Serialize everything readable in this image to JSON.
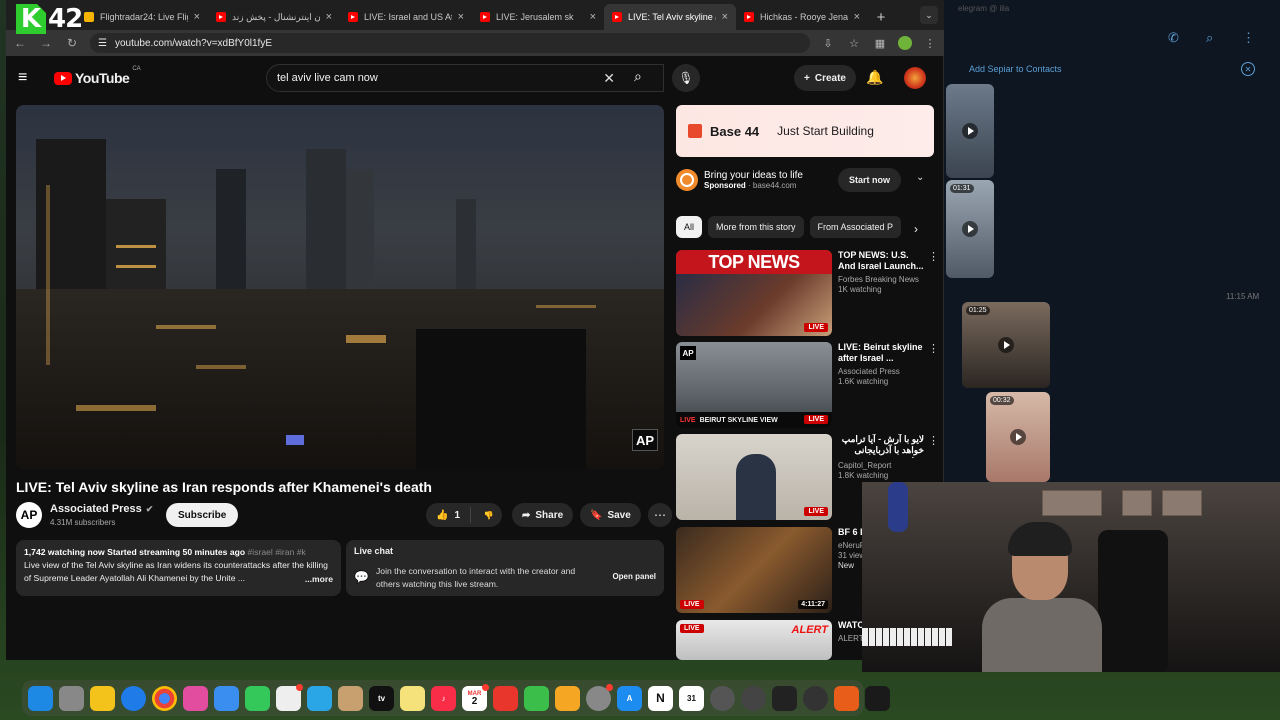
{
  "tabs": [
    {
      "title": "Flightradar24: Live Flig",
      "icon": "plane-icon",
      "active": false
    },
    {
      "title": "ایران اینترنشنال - پخش زند",
      "icon": "youtube-icon",
      "active": false
    },
    {
      "title": "LIVE: Israel and US Att",
      "icon": "youtube-icon",
      "active": false
    },
    {
      "title": "LIVE: Jerusalem sk",
      "icon": "youtube-icon",
      "active": false
    },
    {
      "title": "LIVE: Tel Aviv skyline a",
      "icon": "youtube-icon",
      "active": true
    },
    {
      "title": "Hichkas - Rooye Jenab",
      "icon": "youtube-icon",
      "active": false
    }
  ],
  "overlay_logo": {
    "letter": "K",
    "number": "42"
  },
  "url": "youtube.com/watch?v=xdBfY0l1fyE",
  "youtube": {
    "brand": "YouTube",
    "region": "CA",
    "search_value": "tel aviv live cam now",
    "create_label": "Create"
  },
  "video": {
    "title": "LIVE: Tel Aviv skyline as Iran responds after Khamenei's death",
    "watermark": "AP",
    "channel_logo": "AP",
    "channel": "Associated Press",
    "subscribers": "4.31M subscribers",
    "subscribe_label": "Subscribe",
    "likes": "1",
    "share_label": "Share",
    "save_label": "Save",
    "desc_stats": "1,742 watching now  Started streaming 50 minutes ago",
    "desc_tags": "#israel #iran #k",
    "desc_text": "Live view of the Tel Aviv skyline as Iran widens its counterattacks after the killing of Supreme Leader Ayatollah Ali Khamenei by the Unite ...",
    "desc_more": "...more"
  },
  "livechat": {
    "title": "Live chat",
    "message": "Join the conversation to interact with the creator and others watching this live stream.",
    "open_label": "Open panel"
  },
  "ad": {
    "brand": "Base 44",
    "tagline": "Just Start Building",
    "headline": "Bring your ideas to life",
    "sponsored": "Sponsored",
    "domain": "base44.com",
    "cta": "Start now"
  },
  "chips": [
    "All",
    "More from this story",
    "From Associated P"
  ],
  "recommendations": [
    {
      "title": "TOP NEWS: U.S. And Israel Launch...",
      "channel": "Forbes Breaking News",
      "meta": "1K watching",
      "badge": "LIVE",
      "banner": "TOP NEWS"
    },
    {
      "title": "LIVE: Beirut skyline after Israel ...",
      "channel": "Associated Press",
      "meta": "1.6K watching",
      "badge": "LIVE",
      "banner": "BEIRUT SKYLINE VIEW"
    },
    {
      "title": "لایو با آرش - آیا ترامپ خواهد با آذربایجانی بتوافق",
      "channel": "Capitol_Report",
      "meta": "1.8K watching",
      "badge": "LIVE",
      "banner": ""
    },
    {
      "title": "BF 6 LI Gem D",
      "channel": "eNeruF",
      "meta": "31 views",
      "extra": "New",
      "badge": "LIVE",
      "duration": "4:11:27"
    },
    {
      "title": "WATCH Aviv Sk",
      "channel": "ALERT N",
      "meta": "",
      "badge": "LIVE",
      "banner": "ALERT"
    }
  ],
  "telegram": {
    "header": "elegram @ ilia",
    "add_contact": "Add Sepiar to Contacts",
    "time": "11:15 AM",
    "thumbs": [
      {
        "duration": ""
      },
      {
        "duration": "01:31"
      },
      {
        "duration": "01:25"
      },
      {
        "duration": "00:32"
      }
    ]
  },
  "dock": {
    "calendar_month": "MAR",
    "calendar_day": "2",
    "calendar2_day": "31",
    "tv_label": "tv"
  }
}
